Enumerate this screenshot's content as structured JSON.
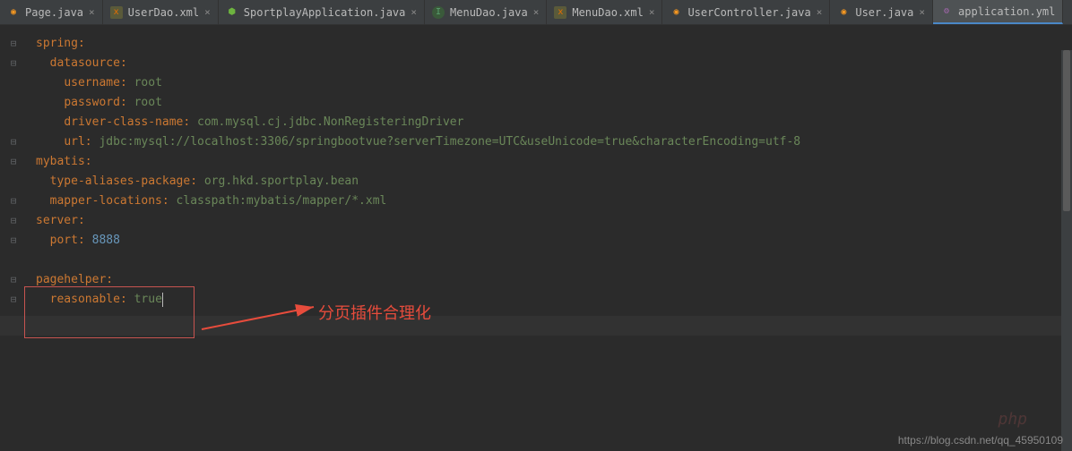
{
  "tabs": [
    {
      "icon": "java",
      "label": "Page.java"
    },
    {
      "icon": "xml",
      "label": "UserDao.xml"
    },
    {
      "icon": "spring",
      "label": "SportplayApplication.java"
    },
    {
      "icon": "interface",
      "label": "MenuDao.java"
    },
    {
      "icon": "xml",
      "label": "MenuDao.xml"
    },
    {
      "icon": "java",
      "label": "UserController.java"
    },
    {
      "icon": "java",
      "label": "User.java"
    },
    {
      "icon": "yml",
      "label": "application.yml",
      "active": true
    }
  ],
  "code": {
    "l1": {
      "k": "spring",
      "c": ":"
    },
    "l2": {
      "k": "datasource",
      "c": ":"
    },
    "l3": {
      "k": "username",
      "c": ": ",
      "v": "root"
    },
    "l4": {
      "k": "password",
      "c": ": ",
      "v": "root"
    },
    "l5": {
      "k": "driver-class-name",
      "c": ": ",
      "v": "com.mysql.cj.jdbc.NonRegisteringDriver"
    },
    "l6": {
      "k": "url",
      "c": ": ",
      "v": "jdbc:mysql://localhost:3306/springbootvue?serverTimezone=UTC&useUnicode=true&characterEncoding=utf-8"
    },
    "l7": {
      "k": "mybatis",
      "c": ":"
    },
    "l8": {
      "k": "type-aliases-package",
      "c": ": ",
      "v": "org.hkd.sportplay.bean"
    },
    "l9": {
      "k": "mapper-locations",
      "c": ": ",
      "v": "classpath:mybatis/mapper/*.xml"
    },
    "l10": {
      "k": "server",
      "c": ":"
    },
    "l11": {
      "k": "port",
      "c": ": ",
      "v": "8888"
    },
    "l13": {
      "k": "pagehelper",
      "c": ":"
    },
    "l14": {
      "k": "reasonable",
      "c": ": ",
      "v": "true"
    }
  },
  "annotation": "分页插件合理化",
  "watermark": "https://blog.csdn.net/qq_45950109",
  "logo": "php"
}
